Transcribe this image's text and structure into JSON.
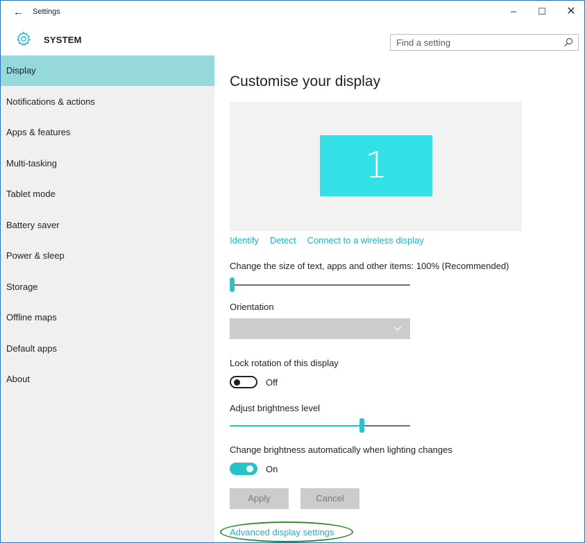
{
  "window": {
    "title": "Settings",
    "back_icon": "arrow-left-icon",
    "controls": {
      "minimize": "–",
      "maximize": "☐",
      "close": "✕"
    }
  },
  "header": {
    "icon": "gear-icon",
    "title": "SYSTEM",
    "search": {
      "placeholder": "Find a setting",
      "value": "",
      "icon": "search-icon"
    }
  },
  "sidebar": {
    "items": [
      {
        "label": "Display",
        "selected": true
      },
      {
        "label": "Notifications & actions"
      },
      {
        "label": "Apps & features"
      },
      {
        "label": "Multi-tasking"
      },
      {
        "label": "Tablet mode"
      },
      {
        "label": "Battery saver"
      },
      {
        "label": "Power & sleep"
      },
      {
        "label": "Storage"
      },
      {
        "label": "Offline maps"
      },
      {
        "label": "Default apps"
      },
      {
        "label": "About"
      }
    ]
  },
  "main": {
    "heading": "Customise your display",
    "monitor_number": "1",
    "links": {
      "identify": "Identify",
      "detect": "Detect",
      "wireless": "Connect to a wireless display"
    },
    "scale": {
      "label": "Change the size of text, apps and other items: 100% (Recommended)",
      "level": 0.0
    },
    "orientation": {
      "label": "Orientation",
      "value": ""
    },
    "lock_rotation": {
      "label": "Lock rotation of this display",
      "state": "Off"
    },
    "brightness": {
      "label": "Adjust brightness level",
      "level": 0.74
    },
    "auto_brightness": {
      "label": "Change brightness automatically when lighting changes",
      "state": "On"
    },
    "buttons": {
      "apply": "Apply",
      "cancel": "Cancel"
    },
    "advanced_link": "Advanced display settings"
  },
  "colors": {
    "accent": "#27c3c6",
    "selected_bg": "#96d9dc",
    "link": "#1ab2c2",
    "sidebar_bg": "#f0f0f0"
  }
}
